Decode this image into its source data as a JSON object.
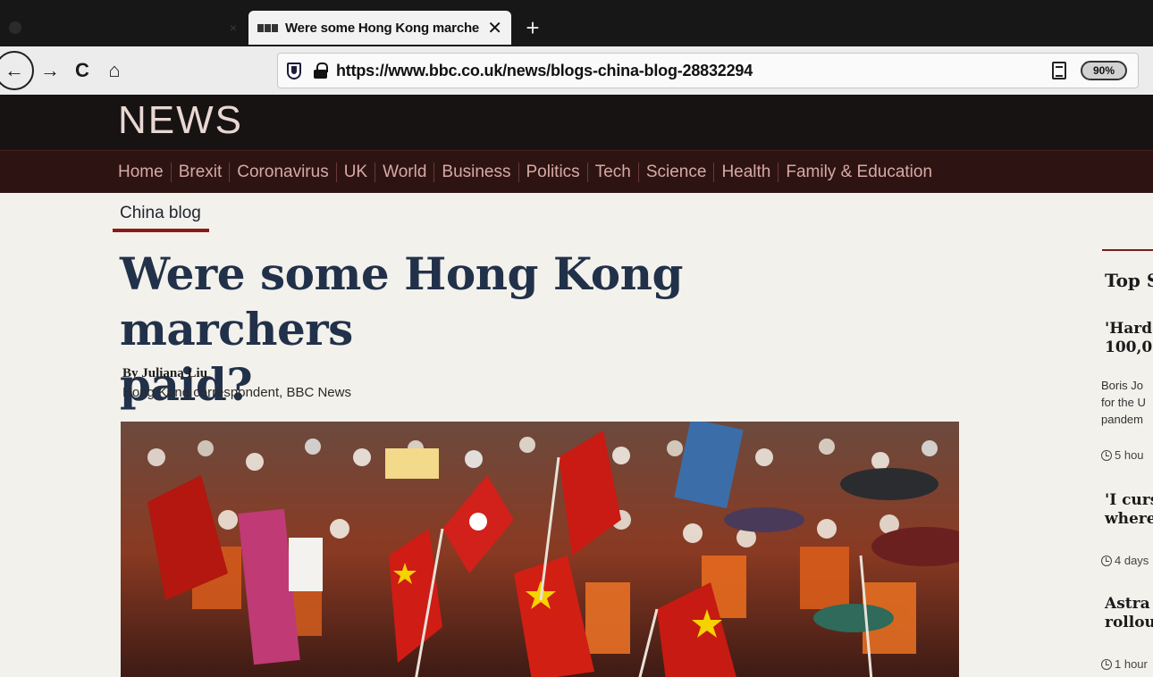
{
  "browser": {
    "inactive_tab": {
      "title": "",
      "close": "×"
    },
    "active_tab": {
      "title": "Were some Hong Kong marche",
      "close": "✕"
    },
    "new_tab": "+",
    "nav": {
      "back": "←",
      "forward": "→",
      "reload": "C",
      "home": "⌂"
    },
    "url": "https://www.bbc.co.uk/news/blogs-china-blog-28832294",
    "zoom": "90%"
  },
  "site": {
    "logo": "NEWS",
    "nav_items": [
      "Home",
      "Brexit",
      "Coronavirus",
      "UK",
      "World",
      "Business",
      "Politics",
      "Tech",
      "Science",
      "Health",
      "Family & Education"
    ]
  },
  "article": {
    "section": "China blog",
    "headline_line1": "Were some Hong Kong marchers",
    "headline_line2": "paid?",
    "author": "By Juliana Liu",
    "author_role": "Hong Kong correspondent, BBC News"
  },
  "rail": {
    "heading": "Top S",
    "stories": [
      {
        "title_lines": [
          "'Hard",
          "100,0"
        ],
        "summary_lines": [
          "Boris Jo",
          "for the U",
          "pandem"
        ],
        "time": "5 hou"
      },
      {
        "title_lines": [
          "'I curs",
          "where"
        ],
        "summary_lines": [],
        "time": "4 days"
      },
      {
        "title_lines": [
          "Astra",
          "rollou"
        ],
        "summary_lines": [],
        "time": "1 hour"
      }
    ]
  },
  "colors": {
    "header_bg": "#171313",
    "nav_bg": "#2d1412",
    "nav_text": "#d8a9a3",
    "headline": "#22314a",
    "accent": "#8a1a1a"
  }
}
